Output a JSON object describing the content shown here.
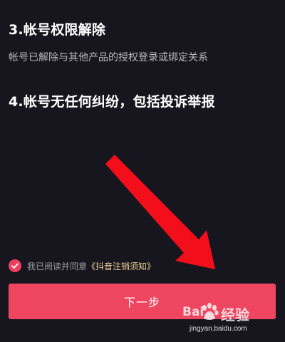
{
  "sections": {
    "item3_title": "3.帐号权限解除",
    "item3_desc": "帐号已解除与其他产品的授权登录或绑定关系",
    "item4_title": "4.帐号无任何纠纷，包括投诉举报"
  },
  "agreement": {
    "prefix": "我已阅读并同意",
    "link": "《抖音注销须知》",
    "checked": true
  },
  "next_button": {
    "label": "下一步"
  },
  "watermark": {
    "brand_left": "Bai",
    "brand_right": "经验",
    "url": "jingyan.baidu.com"
  },
  "colors": {
    "background": "#17161f",
    "accent": "#ee4660",
    "link": "#f2d39a",
    "arrow": "#f20f1b"
  },
  "icons": {
    "checkbox": "checkmark-icon",
    "annotation": "red-arrow-icon",
    "watermark": "baidu-paw-icon"
  }
}
